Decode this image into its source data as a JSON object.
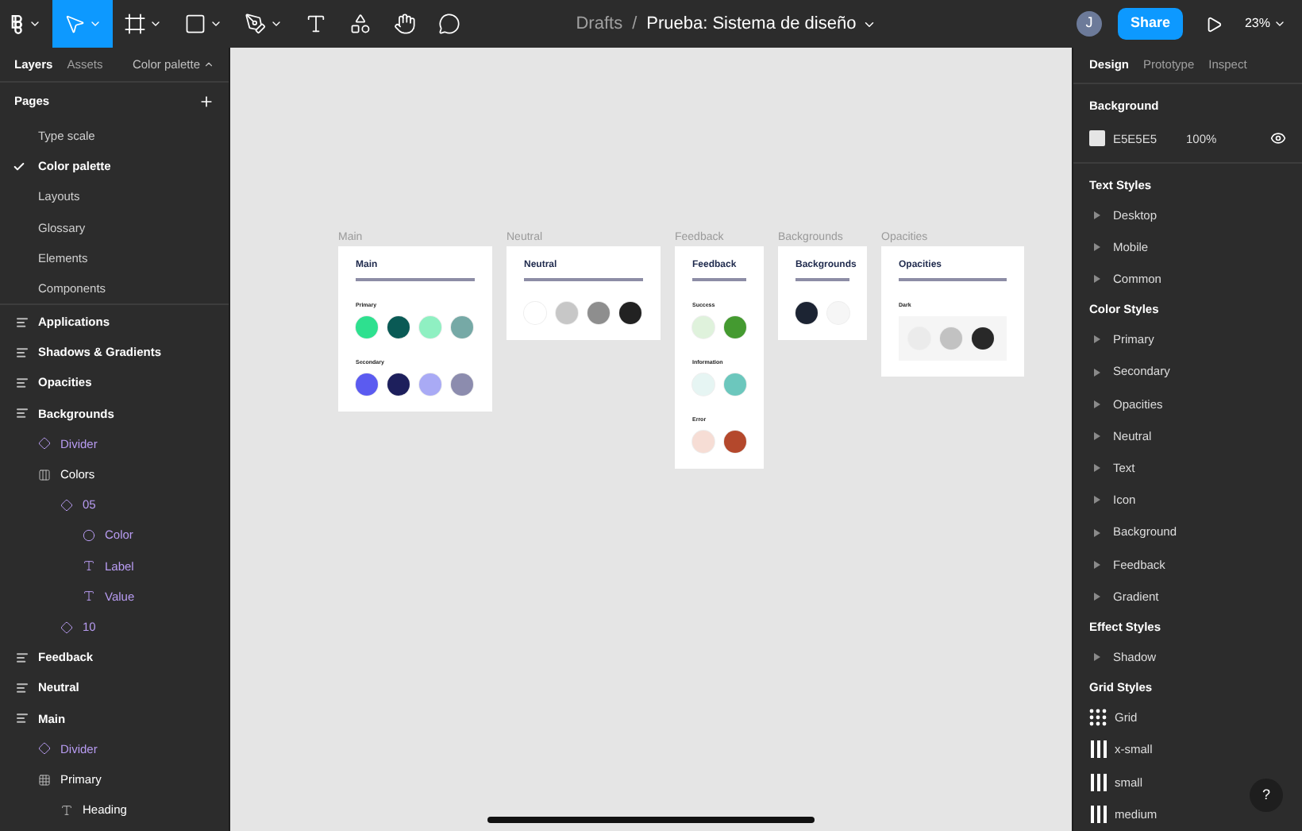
{
  "toolbar": {
    "tools": [
      {
        "kind": "logo",
        "selected": false
      },
      {
        "kind": "move",
        "selected": true
      },
      {
        "kind": "frame",
        "selected": false
      },
      {
        "kind": "shape",
        "selected": false
      },
      {
        "kind": "pen",
        "selected": false
      },
      {
        "kind": "text",
        "selected": false
      },
      {
        "kind": "resources",
        "selected": false
      },
      {
        "kind": "hand",
        "selected": false
      },
      {
        "kind": "comment",
        "selected": false
      }
    ],
    "breadcrumb": {
      "folder": "Drafts",
      "separator": "/",
      "file": "Prueba: Sistema de diseño"
    },
    "avatar": "J",
    "share": "Share",
    "zoom": "23%"
  },
  "left_panel": {
    "tabs": [
      {
        "label": "Layers",
        "selected": true
      },
      {
        "label": "Assets",
        "selected": false
      }
    ],
    "page_menu": "Color palette",
    "pages_title": "Pages",
    "pages": [
      {
        "label": "Type scale",
        "selected": false
      },
      {
        "label": "Color palette",
        "selected": true
      },
      {
        "label": "Layouts",
        "selected": false
      },
      {
        "label": "Glossary",
        "selected": false
      },
      {
        "label": "Elements",
        "selected": false
      },
      {
        "label": "Components",
        "selected": false
      }
    ],
    "layers": [
      {
        "name": "Applications",
        "kind": "frame"
      },
      {
        "name": "Shadows & Gradients",
        "kind": "frame"
      },
      {
        "name": "Opacities",
        "kind": "frame"
      },
      {
        "name": "Backgrounds",
        "kind": "frame",
        "children": [
          {
            "name": "Divider",
            "kind": "component"
          },
          {
            "name": "Colors",
            "kind": "autolayout",
            "children": [
              {
                "name": "05",
                "kind": "component",
                "children": [
                  {
                    "name": "Color",
                    "kind": "ellipse"
                  },
                  {
                    "name": "Label",
                    "kind": "text"
                  },
                  {
                    "name": "Value",
                    "kind": "text"
                  }
                ]
              },
              {
                "name": "10",
                "kind": "component"
              }
            ]
          }
        ]
      },
      {
        "name": "Feedback",
        "kind": "frame"
      },
      {
        "name": "Neutral",
        "kind": "frame"
      },
      {
        "name": "Main",
        "kind": "frame",
        "children": [
          {
            "name": "Divider",
            "kind": "component"
          },
          {
            "name": "Primary",
            "kind": "grid",
            "children": [
              {
                "name": "Heading",
                "kind": "text"
              }
            ]
          }
        ]
      }
    ]
  },
  "canvas": {
    "frames": [
      {
        "label": "Main",
        "title": "Main",
        "groups": [
          {
            "label": "Primary",
            "swatches": [
              {
                "color": "#2ee08f"
              },
              {
                "color": "#0a5a55"
              },
              {
                "color": "#8ff0c2"
              },
              {
                "color": "#76a9a6"
              }
            ]
          },
          {
            "label": "Secondary",
            "swatches": [
              {
                "color": "#5b5bf0"
              },
              {
                "color": "#1d1f5c"
              },
              {
                "color": "#a9aaf5"
              },
              {
                "color": "#8c8cae"
              }
            ]
          }
        ]
      },
      {
        "label": "Neutral",
        "title": "Neutral",
        "groups": [
          {
            "swatches": [
              {
                "color": "#ffffff"
              },
              {
                "color": "#c7c7c7"
              },
              {
                "color": "#8e8e8e"
              },
              {
                "color": "#222222"
              }
            ]
          }
        ]
      },
      {
        "label": "Feedback",
        "title": "Feedback",
        "groups": [
          {
            "label": "Success",
            "swatches": [
              {
                "color": "#dff2dc"
              },
              {
                "color": "#449a30"
              }
            ]
          },
          {
            "label": "Information",
            "swatches": [
              {
                "color": "#e6f5f3"
              },
              {
                "color": "#6cc7bd"
              }
            ]
          },
          {
            "label": "Error",
            "swatches": [
              {
                "color": "#f6ddd5"
              },
              {
                "color": "#b4482c"
              }
            ]
          }
        ]
      },
      {
        "label": "Backgrounds",
        "title": "Backgrounds",
        "groups": [
          {
            "swatches": [
              {
                "color": "#1c2433"
              },
              {
                "color": "#f6f6f6"
              }
            ]
          }
        ]
      },
      {
        "label": "Opacities",
        "title": "Opacities",
        "groups": [
          {
            "label": "Dark",
            "panel": true,
            "swatches": [
              {
                "color": "#ebebeb"
              },
              {
                "color": "#c2c2c2"
              },
              {
                "color": "#282828"
              }
            ]
          }
        ]
      }
    ]
  },
  "right_panel": {
    "tabs": [
      {
        "label": "Design",
        "selected": true
      },
      {
        "label": "Prototype",
        "selected": false
      },
      {
        "label": "Inspect",
        "selected": false
      }
    ],
    "background": {
      "title": "Background",
      "color": "#e5e5e5",
      "hex": "E5E5E5",
      "opacity": "100%",
      "visible": true
    },
    "sections": [
      {
        "title": "Text Styles",
        "items": [
          {
            "label": "Desktop",
            "kind": "folder"
          },
          {
            "label": "Mobile",
            "kind": "folder"
          },
          {
            "label": "Common",
            "kind": "folder"
          }
        ]
      },
      {
        "title": "Color Styles",
        "items": [
          {
            "label": "Primary",
            "kind": "folder"
          },
          {
            "label": "Secondary",
            "kind": "folder"
          },
          {
            "label": "Opacities",
            "kind": "folder"
          },
          {
            "label": "Neutral",
            "kind": "folder"
          },
          {
            "label": "Text",
            "kind": "folder"
          },
          {
            "label": "Icon",
            "kind": "folder"
          },
          {
            "label": "Background",
            "kind": "folder"
          },
          {
            "label": "Feedback",
            "kind": "folder"
          },
          {
            "label": "Gradient",
            "kind": "folder"
          }
        ]
      },
      {
        "title": "Effect Styles",
        "items": [
          {
            "label": "Shadow",
            "kind": "folder"
          }
        ]
      },
      {
        "title": "Grid Styles",
        "items": [
          {
            "label": "Grid",
            "kind": "grid"
          },
          {
            "label": "x-small",
            "kind": "columns"
          },
          {
            "label": "small",
            "kind": "columns"
          },
          {
            "label": "medium",
            "kind": "columns"
          }
        ]
      }
    ]
  },
  "help": "?"
}
